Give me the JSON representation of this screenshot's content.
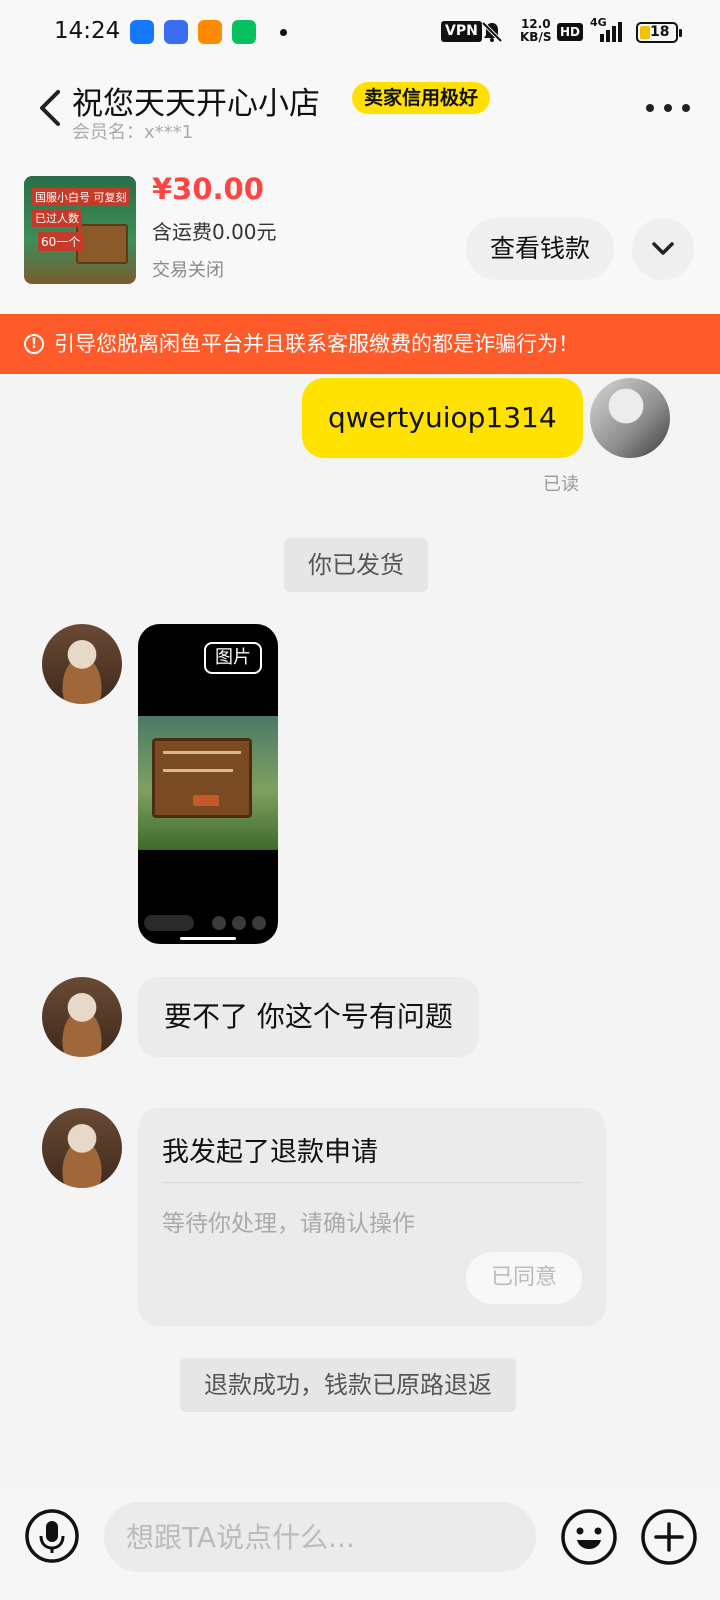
{
  "status_bar": {
    "time": "14:24",
    "vpn": "VPN",
    "speed_value": "12.0",
    "speed_unit": "KB/S",
    "hd": "HD",
    "network": "4G",
    "battery": "18",
    "app_colors": [
      "#1677ff",
      "#3b6df0",
      "#ff8a00",
      "#07c160"
    ]
  },
  "header": {
    "shop_name": "祝您天天开心小店",
    "credit_badge": "卖家信用极好",
    "member_label": "会员名：x***1",
    "icons": {
      "back": "chevron-left-icon",
      "more": "more-dots-icon"
    }
  },
  "product": {
    "thumb_line1": "国服小白号 可复刻",
    "thumb_line2": "已过人数",
    "thumb_line3": "60一个",
    "price": "¥30.00",
    "shipping": "含运费0.00元",
    "status": "交易关闭",
    "view_money_label": "查看钱款",
    "expand_icon": "chevron-down-icon"
  },
  "warning": {
    "icon": "exclamation-circle-icon",
    "text": "引导您脱离闲鱼平台并且联系客服缴费的都是诈骗行为！",
    "color": "#ff5a2a"
  },
  "messages": {
    "mine_text": "qwertyuiop1314",
    "mine_read": "已读",
    "shipped_note": "你已发货",
    "image_tag": "图片",
    "reply_text": "要不了 你这个号有问题",
    "refund_title": "我发起了退款申请",
    "refund_sub": "等待你处理，请确认操作",
    "refund_button": "已同意",
    "refund_done_note": "退款成功，钱款已原路退返"
  },
  "input_bar": {
    "placeholder": "想跟TA说点什么...",
    "icons": {
      "voice": "microphone-icon",
      "emoji": "emoji-icon",
      "more": "plus-icon"
    }
  },
  "colors": {
    "accent_yellow": "#ffe200",
    "price_red": "#ff4444",
    "background": "#f4f4f4"
  }
}
